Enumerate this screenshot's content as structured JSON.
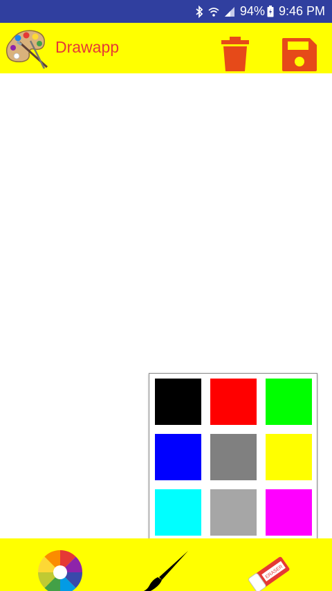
{
  "statusbar": {
    "battery": "94%",
    "time": "9:46 PM",
    "icons": [
      "bluetooth-icon",
      "wifi-icon",
      "signal-icon",
      "battery-charging-icon"
    ]
  },
  "appbar": {
    "title": "Drawapp",
    "logo_icon": "palette-icon",
    "actions": [
      "trash-icon",
      "save-icon"
    ],
    "accent": "#ffff00",
    "action_color": "#e64a19",
    "title_color": "#e53935"
  },
  "palette": {
    "colors": [
      "#000000",
      "#ff0000",
      "#00ff00",
      "#0000ff",
      "#808080",
      "#ffff00",
      "#00ffff",
      "#a6a6a6",
      "#ff00ff"
    ]
  },
  "bottombar": {
    "tools": [
      "color-wheel-icon",
      "brush-icon",
      "eraser-icon"
    ],
    "eraser_text": "ERASER"
  }
}
